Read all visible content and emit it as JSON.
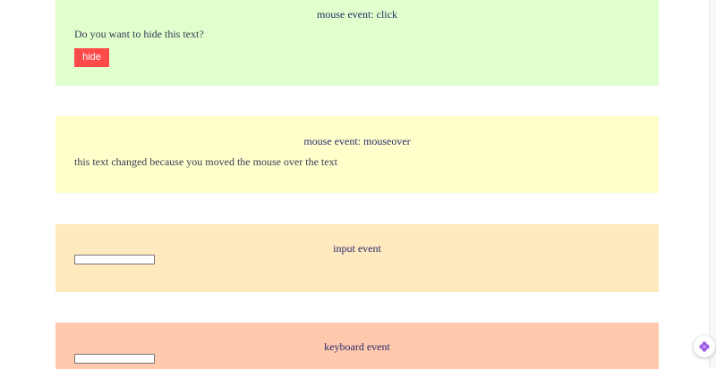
{
  "sections": {
    "click": {
      "title": "mouse event: click",
      "text": "Do you want to hide this text?",
      "button_label": "hide"
    },
    "mouseover": {
      "title": "mouse event: mouseover",
      "text": "this text changed because you moved the mouse over the text"
    },
    "input": {
      "title": "input event",
      "field_value": ""
    },
    "keyboard": {
      "title": "keyboard event",
      "field_value": ""
    }
  },
  "colors": {
    "click_bg": "#dfffcc",
    "mouseover_bg": "#ffffcc",
    "input_bg": "#ffe9bf",
    "keyboard_bg": "#ffc9ae",
    "hide_button": "#ff4a4a",
    "widget_accent": "#9b5de5"
  },
  "icons": {
    "floating_widget": "flower-icon"
  }
}
